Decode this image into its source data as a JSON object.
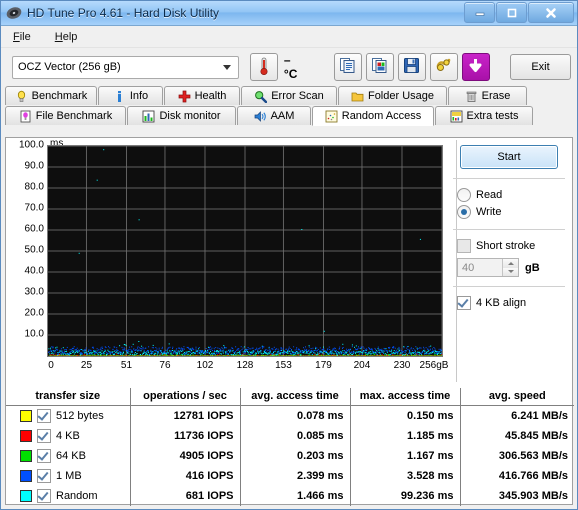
{
  "window": {
    "title": "HD Tune Pro 4.61 - Hard Disk Utility",
    "icon": "disk-icon",
    "minimize": "–",
    "maximize": "□",
    "close": "✕"
  },
  "menu": {
    "items": [
      {
        "label": "File",
        "accel": "F"
      },
      {
        "label": "Help",
        "accel": "H"
      }
    ]
  },
  "toolbar": {
    "drive": "OCZ Vector (256 gB)",
    "temperature": "– °C",
    "thermometer_icon": "thermometer-icon",
    "buttons": [
      {
        "name": "copy-text-icon",
        "title": "copy"
      },
      {
        "name": "copy-image-icon",
        "title": "copy image"
      },
      {
        "name": "save-icon",
        "title": "save"
      },
      {
        "name": "plug-icon",
        "title": "options"
      },
      {
        "name": "download-icon",
        "title": "download"
      }
    ],
    "exit_label": "Exit"
  },
  "tabs": {
    "row1": [
      {
        "label": "Benchmark",
        "icon": "lightbulb-icon",
        "active": false
      },
      {
        "label": "Info",
        "icon": "info-icon",
        "active": false
      },
      {
        "label": "Health",
        "icon": "cross-icon",
        "active": false
      },
      {
        "label": "Error Scan",
        "icon": "magnifier-icon",
        "active": false
      },
      {
        "label": "Folder Usage",
        "icon": "folder-icon",
        "active": false
      },
      {
        "label": "Erase",
        "icon": "trash-icon",
        "active": false
      }
    ],
    "row2": [
      {
        "label": "File Benchmark",
        "icon": "file-bulb-icon",
        "active": false
      },
      {
        "label": "Disk monitor",
        "icon": "bars-icon",
        "active": false
      },
      {
        "label": "AAM",
        "icon": "speaker-icon",
        "active": false
      },
      {
        "label": "Random Access",
        "icon": "scatter-icon",
        "active": true
      },
      {
        "label": "Extra tests",
        "icon": "grid-icon",
        "active": false
      }
    ]
  },
  "controls": {
    "start_label": "Start",
    "mode_read": "Read",
    "mode_write": "Write",
    "mode_selected": "Write",
    "short_stroke_label": "Short stroke",
    "short_stroke_checked": false,
    "short_stroke_value": "40",
    "short_stroke_unit": "gB",
    "align_label": "4 KB align",
    "align_checked": true
  },
  "chart_data": {
    "type": "scatter",
    "title": "",
    "ylabel": "ms",
    "xlabel": "",
    "xunit": "gB",
    "ylim": [
      0,
      100
    ],
    "xlim": [
      0,
      256
    ],
    "yticks": [
      "100.0",
      "90.0",
      "80.0",
      "70.0",
      "60.0",
      "50.0",
      "40.0",
      "30.0",
      "20.0",
      "10.0"
    ],
    "ytick_values": [
      100,
      90,
      80,
      70,
      60,
      50,
      40,
      30,
      20,
      10
    ],
    "xticks": [
      "0",
      "25",
      "51",
      "76",
      "102",
      "128",
      "153",
      "179",
      "204",
      "230",
      "256gB"
    ],
    "xtick_values": [
      0,
      25,
      51,
      76,
      102,
      128,
      153,
      179,
      204,
      230,
      256
    ],
    "grid": true,
    "background": "#0e0e0e",
    "gridcolor": "#6f6f6f",
    "series": [
      {
        "name": "512 bytes",
        "color": "#ffff00",
        "mean_ms": 0.078,
        "max_ms": 0.15
      },
      {
        "name": "4 KB",
        "color": "#ff0000",
        "mean_ms": 0.085,
        "max_ms": 1.185
      },
      {
        "name": "64 KB",
        "color": "#00e000",
        "mean_ms": 0.203,
        "max_ms": 1.167
      },
      {
        "name": "1 MB",
        "color": "#0050ff",
        "mean_ms": 2.399,
        "max_ms": 3.528
      },
      {
        "name": "Random",
        "color": "#00ffff",
        "mean_ms": 1.466,
        "max_ms": 99.236
      }
    ],
    "note": "dense scatter band concentrated between 0 and ~4 ms across the full 0-256 gB span"
  },
  "results": {
    "headers": [
      "transfer size",
      "operations / sec",
      "avg. access time",
      "max. access time",
      "avg. speed"
    ],
    "rows": [
      {
        "color": "#ffff00",
        "checked": true,
        "size": "512 bytes",
        "iops": "12781 IOPS",
        "avg_access": "0.078 ms",
        "max_access": "0.150 ms",
        "speed": "6.241 MB/s"
      },
      {
        "color": "#ff0000",
        "checked": true,
        "size": "4 KB",
        "iops": "11736 IOPS",
        "avg_access": "0.085 ms",
        "max_access": "1.185 ms",
        "speed": "45.845 MB/s"
      },
      {
        "color": "#00e000",
        "checked": true,
        "size": "64 KB",
        "iops": "4905 IOPS",
        "avg_access": "0.203 ms",
        "max_access": "1.167 ms",
        "speed": "306.563 MB/s"
      },
      {
        "color": "#0050ff",
        "checked": true,
        "size": "1 MB",
        "iops": "416 IOPS",
        "avg_access": "2.399 ms",
        "max_access": "3.528 ms",
        "speed": "416.766 MB/s"
      },
      {
        "color": "#00ffff",
        "checked": true,
        "size": "Random",
        "iops": "681 IOPS",
        "avg_access": "1.466 ms",
        "max_access": "99.236 ms",
        "speed": "345.903 MB/s"
      }
    ]
  }
}
